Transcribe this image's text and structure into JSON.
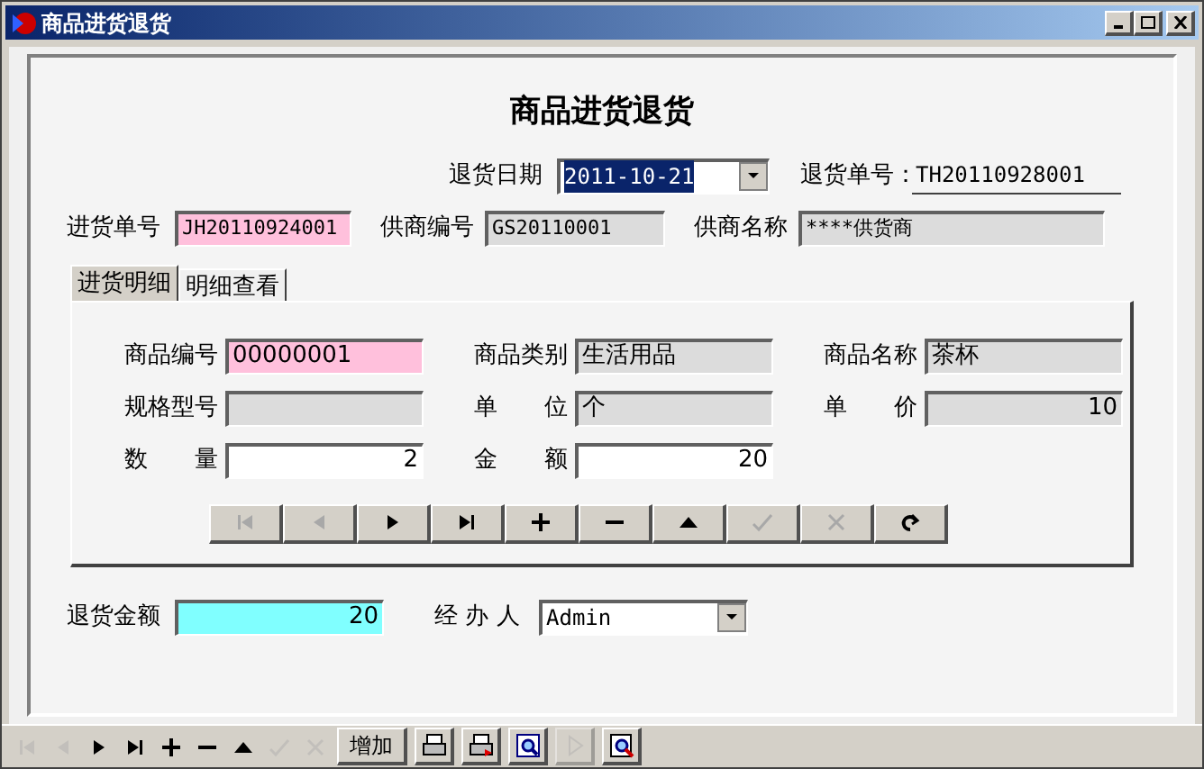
{
  "window": {
    "title": "商品进货退货"
  },
  "heading": "商品进货退货",
  "return_date": {
    "label": "退货日期",
    "value": "2011-10-21",
    "selected": true
  },
  "return_no": {
    "label": "退货单号：",
    "value": "TH20110928001"
  },
  "header_fields": [
    {
      "label": "进货单号",
      "value": "JH20110924001",
      "color": "#ffc0dc"
    },
    {
      "label": "供商编号",
      "value": "GS20110001",
      "color": "#dcdcdc"
    },
    {
      "label": "供商名称",
      "value": "****供货商",
      "color": "#dcdcdc"
    }
  ],
  "tabs": [
    {
      "label": "进货明细",
      "selected": true
    },
    {
      "label": "明细查看",
      "selected": false
    }
  ],
  "detail_fields": [
    {
      "label": "商品编号",
      "value": "00000001",
      "color": "#ffc0dc",
      "kind": "text"
    },
    {
      "label": "商品类别",
      "value": "生活用品",
      "color": "#dcdcdc",
      "kind": "text"
    },
    {
      "label": "商品名称",
      "value": "茶杯",
      "color": "#dcdcdc",
      "kind": "text"
    },
    {
      "label": "规格型号",
      "color": "#dcdcdc",
      "kind": "text"
    },
    {
      "label": "单　　位",
      "value": "个",
      "color": "#dcdcdc",
      "kind": "text"
    },
    {
      "label": "单　　价",
      "value": "10",
      "color": "#dcdcdc",
      "kind": "number"
    },
    {
      "label": "数　　量",
      "value": "2",
      "color": "#ffffff",
      "kind": "number"
    },
    {
      "label": "金　　额",
      "value": "20",
      "color": "#ffffff",
      "kind": "number"
    }
  ],
  "navigator": [
    {
      "kind": "first",
      "disabled": true
    },
    {
      "kind": "prior",
      "disabled": true
    },
    {
      "kind": "next",
      "disabled": false
    },
    {
      "kind": "last",
      "disabled": false
    },
    {
      "kind": "insert",
      "disabled": false
    },
    {
      "kind": "delete",
      "disabled": false
    },
    {
      "kind": "edit",
      "disabled": false
    },
    {
      "kind": "post",
      "disabled": true
    },
    {
      "kind": "cancel",
      "disabled": true
    },
    {
      "kind": "refresh",
      "disabled": false
    }
  ],
  "total": {
    "label": "退货金额",
    "value": "20",
    "color": "#80ffff",
    "kind": "number"
  },
  "handler": {
    "label": "经 办 人",
    "value": "Admin"
  },
  "toolbar": [
    {
      "kind": "first",
      "disabled": true
    },
    {
      "kind": "prior",
      "disabled": true
    },
    {
      "kind": "next",
      "disabled": false
    },
    {
      "kind": "last",
      "disabled": false
    },
    {
      "kind": "insert",
      "disabled": false
    },
    {
      "kind": "delete",
      "disabled": false
    },
    {
      "kind": "edit",
      "disabled": false
    },
    {
      "kind": "post",
      "disabled": true
    },
    {
      "kind": "cancel",
      "disabled": true
    },
    {
      "kind": "text",
      "label": "增加",
      "disabled": false
    },
    {
      "kind": "print",
      "disabled": false
    },
    {
      "kind": "print-red",
      "disabled": false
    },
    {
      "kind": "preview",
      "disabled": false
    },
    {
      "kind": "play",
      "disabled": true
    },
    {
      "kind": "zoom",
      "disabled": false
    }
  ]
}
